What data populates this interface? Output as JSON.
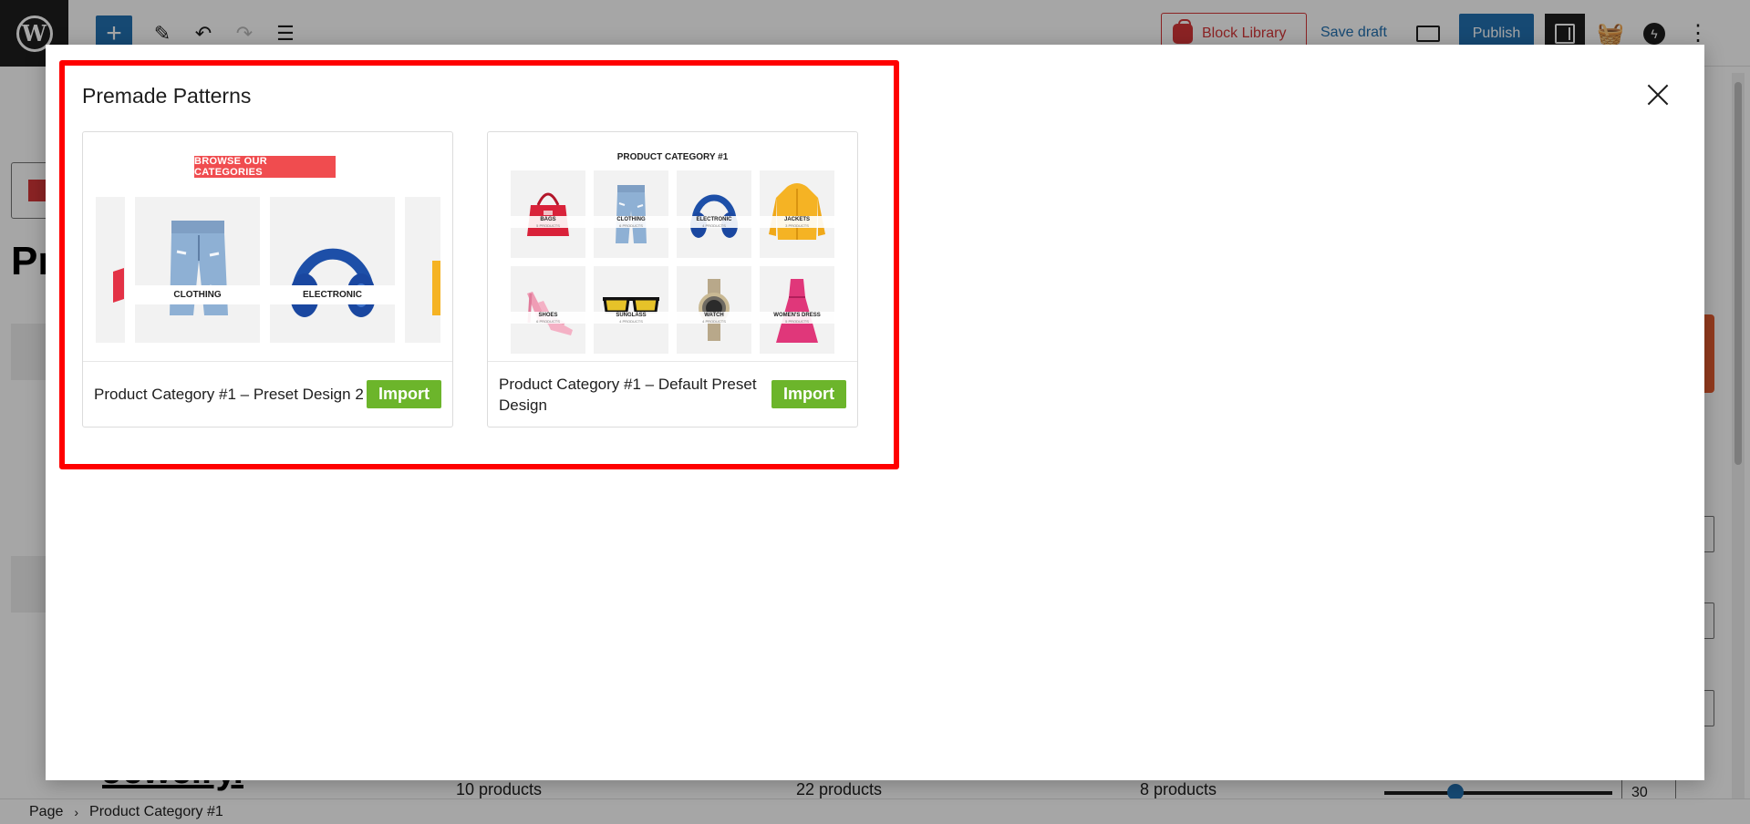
{
  "toolbar": {
    "logo_letter": "W",
    "block_library_label": "Block Library",
    "save_draft_label": "Save draft",
    "publish_label": "Publish"
  },
  "background": {
    "heading_fragment": "Pr",
    "jewelry_fragment": "Jewelry.",
    "counts": [
      "10 products",
      "22 products",
      "8 products"
    ],
    "number_value": "30"
  },
  "statusbar": {
    "crumbs": [
      "Page",
      "Product Category #1"
    ]
  },
  "modal": {
    "title": "Premade Patterns",
    "cards": [
      {
        "name": "Product Category #1 – Preset Design 2",
        "import_label": "Import",
        "preview": {
          "badge": "BROWSE OUR CATEGORIES",
          "tiles": [
            "CLOTHING",
            "ELECTRONIC"
          ]
        }
      },
      {
        "name": "Product Category #1 – Default Preset Design",
        "import_label": "Import",
        "preview": {
          "title": "PRODUCT CATEGORY #1",
          "tiles": [
            {
              "label": "BAGS",
              "sub": "5 PRODUCTS"
            },
            {
              "label": "CLOTHING",
              "sub": "6 PRODUCTS"
            },
            {
              "label": "ELECTRONIC",
              "sub": "4 PRODUCTS"
            },
            {
              "label": "JACKETS",
              "sub": "3 PRODUCTS"
            },
            {
              "label": "SHOES",
              "sub": "6 PRODUCTS"
            },
            {
              "label": "SUNGLASS",
              "sub": "4 PRODUCTS"
            },
            {
              "label": "WATCH",
              "sub": "4 PRODUCTS"
            },
            {
              "label": "WOMEN'S DRESS",
              "sub": "5 PRODUCTS"
            }
          ]
        }
      }
    ]
  },
  "colors": {
    "accent_blue": "#2271b1",
    "import_green": "#6cb52b",
    "highlight_red": "#ff0000",
    "badge_red": "#f04c4f"
  }
}
